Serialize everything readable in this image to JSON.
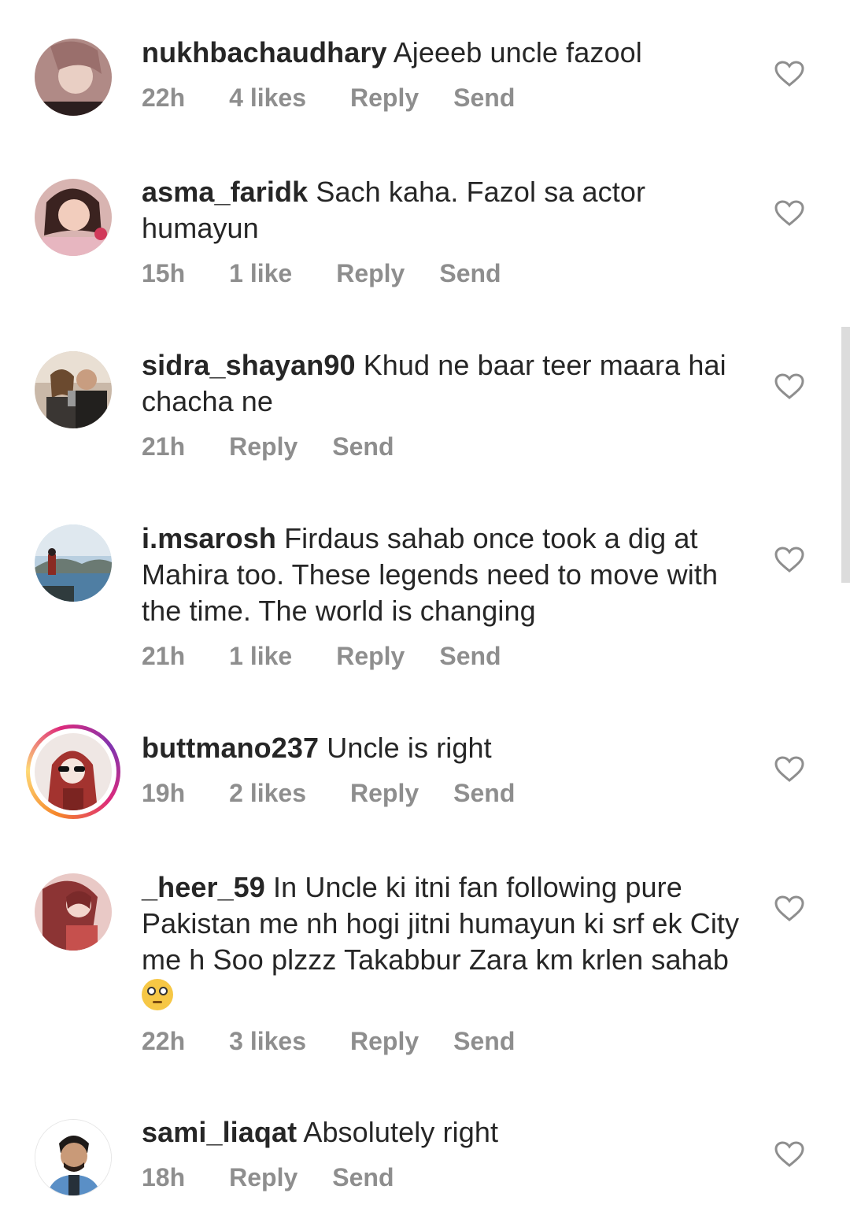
{
  "comments": [
    {
      "username": "nukhbachaudhary",
      "text": "Ajeeeb uncle fazool",
      "time": "22h",
      "likes": "4 likes",
      "reply": "Reply",
      "send": "Send"
    },
    {
      "username": "asma_faridk",
      "text": "Sach kaha. Fazol sa actor humayun",
      "time": "15h",
      "likes": "1 like",
      "reply": "Reply",
      "send": "Send"
    },
    {
      "username": "sidra_shayan90",
      "text": "Khud ne baar teer maara hai chacha ne",
      "time": "21h",
      "reply": "Reply",
      "send": "Send"
    },
    {
      "username": "i.msarosh",
      "text": "Firdaus sahab once took a dig at Mahira too. These legends need to move with the time. The world is changing",
      "time": "21h",
      "likes": "1 like",
      "reply": "Reply",
      "send": "Send"
    },
    {
      "username": "buttmano237",
      "text": "Uncle is right",
      "time": "19h",
      "likes": "2 likes",
      "reply": "Reply",
      "send": "Send"
    },
    {
      "username": "_heer_59",
      "text": "In Uncle ki itni fan following pure Pakistan me nh hogi jitni humayun ki srf ek City me h Soo plzzz Takabbur Zara km krlen sahab",
      "emoji": "face-with-rolling-eyes",
      "time": "22h",
      "likes": "3 likes",
      "reply": "Reply",
      "send": "Send"
    },
    {
      "username": "sami_liaqat",
      "text": "Absolutely right",
      "time": "18h",
      "reply": "Reply",
      "send": "Send"
    }
  ],
  "icons": {
    "like": "heart-outline-icon"
  },
  "colors": {
    "text": "#262626",
    "meta": "#8e8e8e",
    "heart": "#8e8e8e"
  }
}
